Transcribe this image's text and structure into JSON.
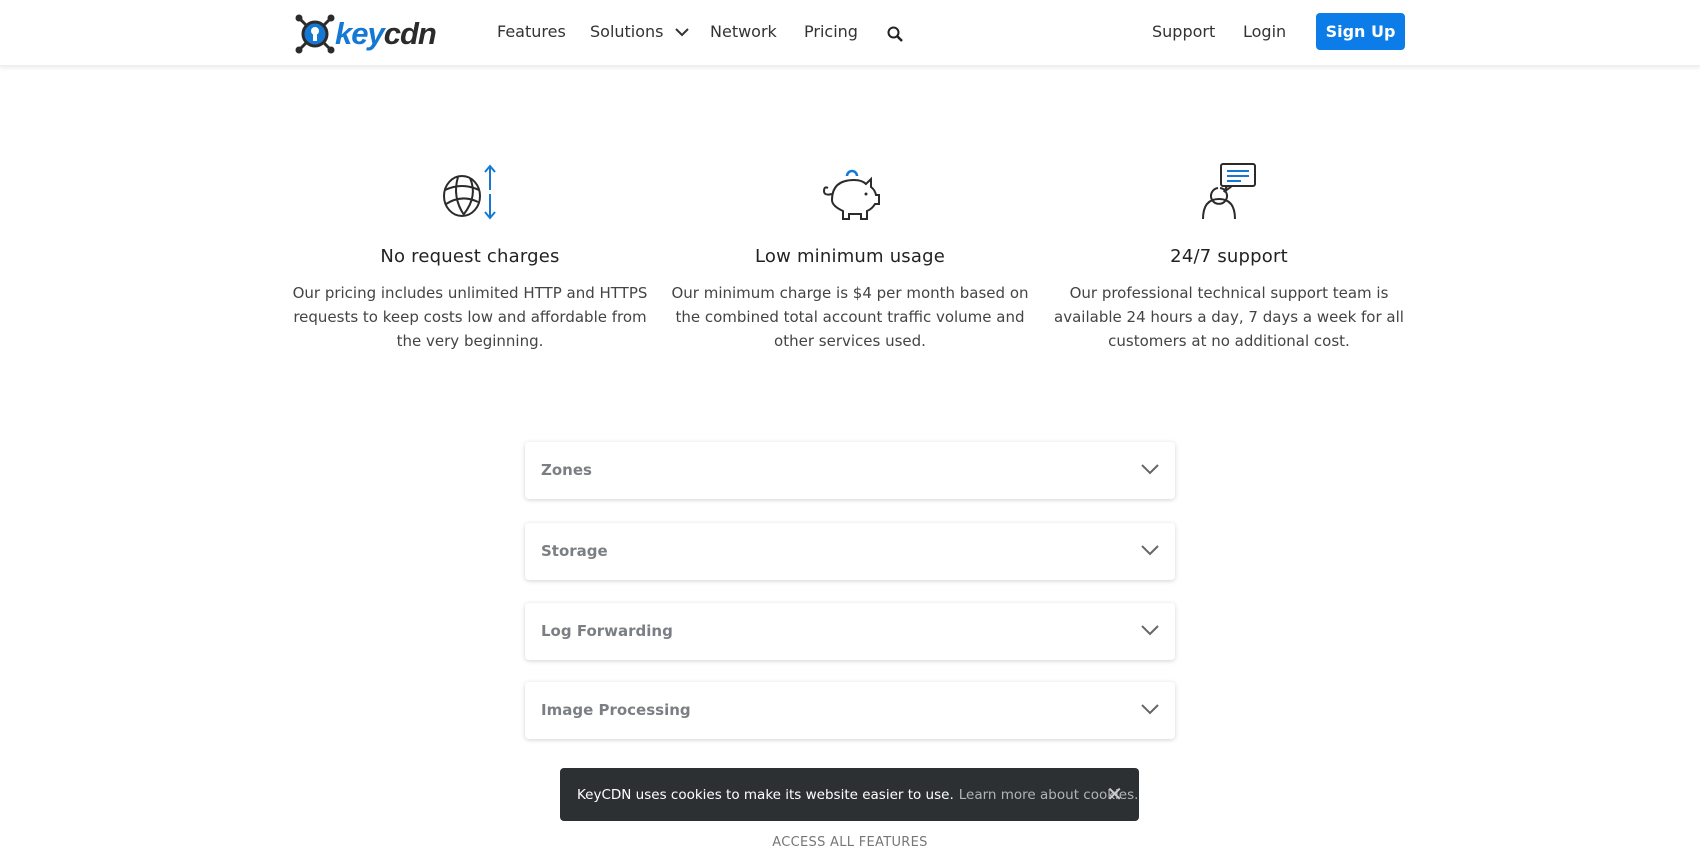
{
  "header": {
    "logo": {
      "key": "key",
      "cdn": "cdn"
    },
    "nav": [
      "Features",
      "Solutions",
      "Network",
      "Pricing"
    ],
    "support": "Support",
    "login": "Login",
    "signup": "Sign Up",
    "accent": "#0b7ce8"
  },
  "features": [
    {
      "icon": "globe-transfer-icon",
      "title": "No request charges",
      "text": "Our pricing includes unlimited HTTP and HTTPS requests to keep costs low and affordable from the very beginning."
    },
    {
      "icon": "piggy-bank-icon",
      "title": "Low minimum usage",
      "text": "Our minimum charge is $4 per month based on the combined total account traffic volume and other services used."
    },
    {
      "icon": "support-person-icon",
      "title": "24/7 support",
      "text": "Our professional technical support team is available 24 hours a day, 7 days a week for all customers at no additional cost."
    }
  ],
  "accordion": [
    "Zones",
    "Storage",
    "Log Forwarding",
    "Image Processing"
  ],
  "cookie": {
    "text": "KeyCDN uses cookies to make its website easier to use.",
    "link": "Learn more about cookies."
  },
  "access_all": "ACCESS ALL FEATURES"
}
